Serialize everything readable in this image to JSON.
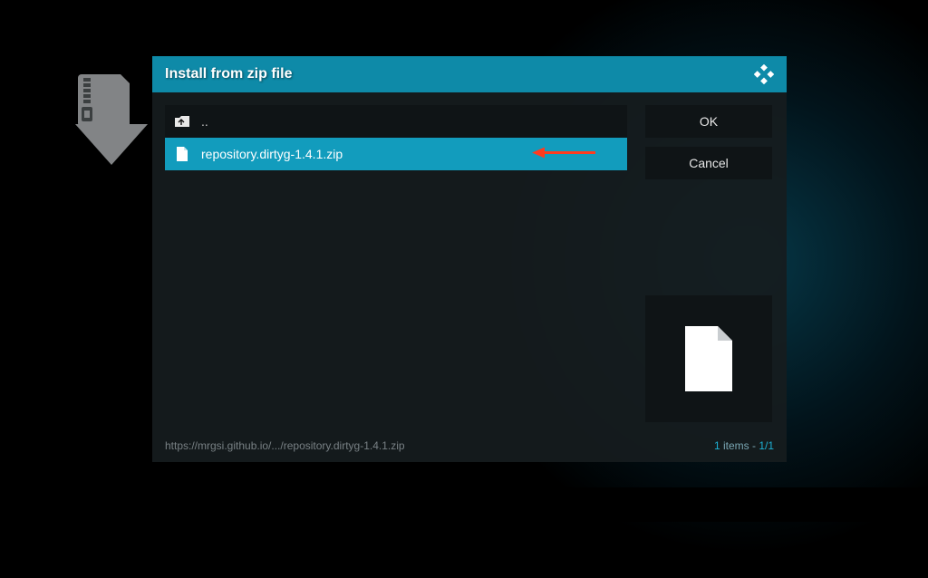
{
  "dialog": {
    "title": "Install from zip file",
    "parent_label": "..",
    "selected_file": "repository.dirtyg-1.4.1.zip",
    "path": "https://mrgsi.github.io/.../repository.dirtyg-1.4.1.zip",
    "items_count_label": "items -",
    "items_count_num": "1",
    "items_page": "1/1"
  },
  "buttons": {
    "ok": "OK",
    "cancel": "Cancel"
  }
}
